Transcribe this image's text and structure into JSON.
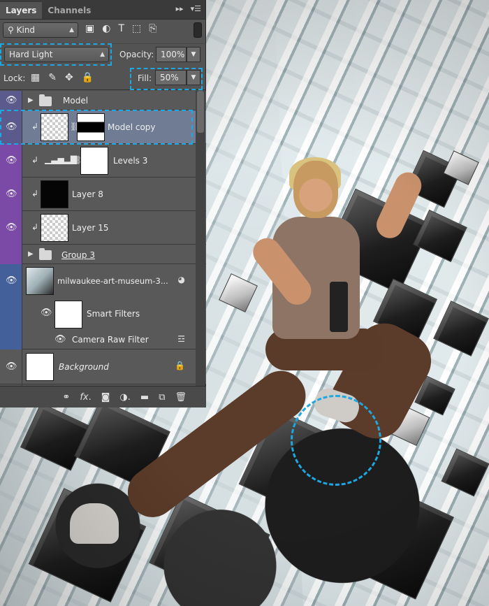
{
  "panel": {
    "tabs": [
      {
        "label": "Layers",
        "active": true
      },
      {
        "label": "Channels",
        "active": false
      }
    ],
    "menu_icons": [
      "collapse-icon",
      "panel-menu-icon"
    ]
  },
  "filter": {
    "kind_label": "Kind",
    "icons": [
      "pixel-filter-icon",
      "adjustment-filter-icon",
      "type-filter-icon",
      "shape-filter-icon",
      "smart-object-filter-icon"
    ]
  },
  "blend": {
    "mode": "Hard Light",
    "opacity_label": "Opacity:",
    "opacity_value": "100%",
    "lock_label": "Lock:",
    "fill_label": "Fill:",
    "fill_value": "50%"
  },
  "layers": [
    {
      "name": "Model",
      "type": "group",
      "stripe": "#5a5a8c"
    },
    {
      "name": "Model copy",
      "type": "layer",
      "selected": true,
      "clipped": true,
      "stripe": "#5a5a8c"
    },
    {
      "name": "Levels 3",
      "type": "adjustment",
      "clipped": true,
      "stripe": "#7a4aa6"
    },
    {
      "name": "Layer 8",
      "type": "layer",
      "clipped": true,
      "stripe": "#7a4aa6"
    },
    {
      "name": "Layer 15",
      "type": "layer",
      "clipped": true,
      "stripe": "#7a4aa6"
    },
    {
      "name": "Group 3",
      "type": "group",
      "stripe": "#7a4aa6"
    },
    {
      "name": "milwaukee-art-museum-3...",
      "type": "smart",
      "stripe": "#44609a"
    },
    {
      "name": "Smart Filters",
      "type": "smart-filters",
      "stripe": "#44609a"
    },
    {
      "name": "Camera Raw Filter",
      "type": "filter",
      "stripe": "#44609a"
    },
    {
      "name": "Background",
      "type": "background",
      "stripe": "#535353"
    }
  ],
  "footer_icons": [
    "link-layers-icon",
    "fx-icon",
    "add-mask-icon",
    "new-adjustment-icon",
    "new-group-icon",
    "new-layer-icon",
    "delete-icon"
  ],
  "colors": {
    "highlight_dash": "#1ea7e1",
    "selected_row": "#6f7c93",
    "panel_bg": "#535353"
  }
}
